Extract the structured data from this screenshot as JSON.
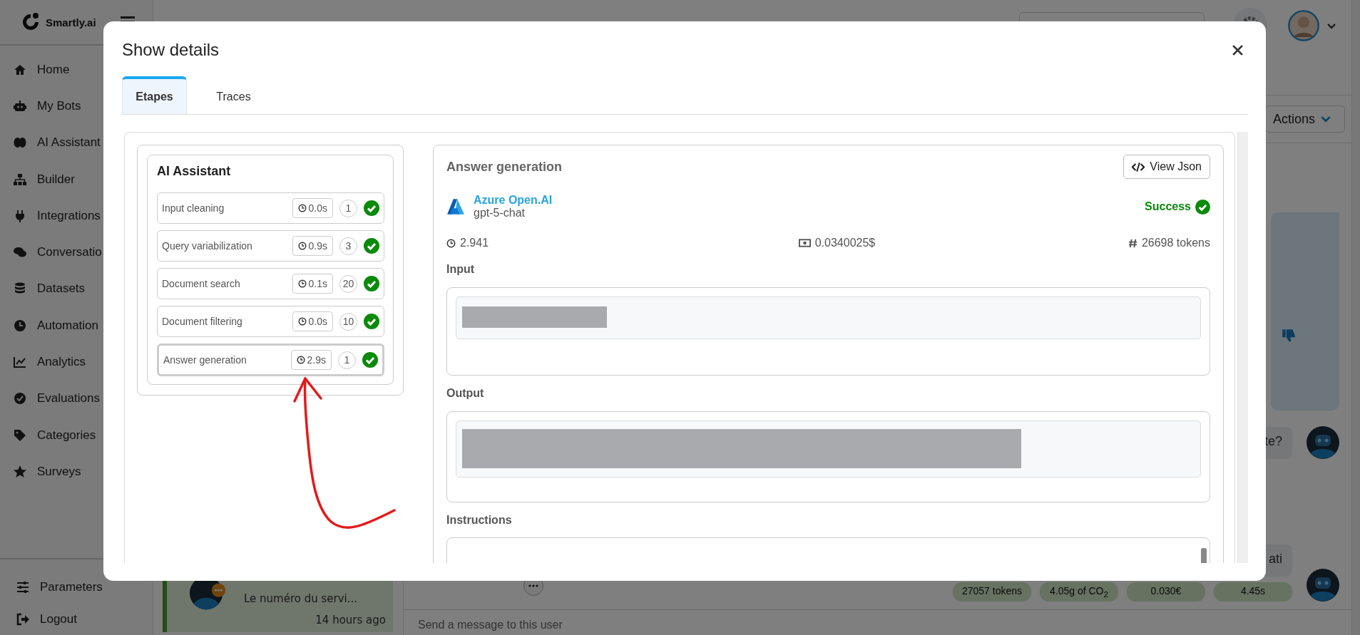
{
  "sidebar": {
    "brand": "Smartly.ai",
    "items": [
      {
        "label": "Home"
      },
      {
        "label": "My Bots"
      },
      {
        "label": "AI Assistant"
      },
      {
        "label": "Builder"
      },
      {
        "label": "Integrations"
      },
      {
        "label": "Conversatio"
      },
      {
        "label": "Datasets"
      },
      {
        "label": "Automation"
      },
      {
        "label": "Analytics"
      },
      {
        "label": "Evaluations"
      },
      {
        "label": "Categories"
      },
      {
        "label": "Surveys"
      }
    ],
    "footer_items": [
      {
        "label": "Parameters"
      },
      {
        "label": "Logout"
      }
    ]
  },
  "toolbar": {
    "actions_button": "Actions"
  },
  "conversation_list": {
    "items": [
      {
        "preview": "Le numéro du servi...",
        "time": "14 hours ago"
      }
    ]
  },
  "chat": {
    "messages": [
      {
        "text": "te?"
      },
      {
        "text": "ati"
      }
    ],
    "stats": [
      "27057 tokens",
      "4.05g of CO$_{2}$",
      "0.030€",
      "4.45s"
    ]
  },
  "composer": {
    "placeholder": "Send a message to this user"
  },
  "modal": {
    "title": "Show details",
    "tabs": [
      {
        "label": "Etapes",
        "selected": true
      },
      {
        "label": "Traces",
        "selected": false
      }
    ],
    "assistant": {
      "title": "AI Assistant",
      "steps": [
        {
          "name": "Input cleaning",
          "duration": "0.0s",
          "count": "1",
          "success": true,
          "selected": false
        },
        {
          "name": "Query variabilization",
          "duration": "0.9s",
          "count": "3",
          "success": true,
          "selected": false
        },
        {
          "name": "Document search",
          "duration": "0.1s",
          "count": "20",
          "success": true,
          "selected": false
        },
        {
          "name": "Document filtering",
          "duration": "0.0s",
          "count": "10",
          "success": true,
          "selected": false
        },
        {
          "name": "Answer generation",
          "duration": "2.9s",
          "count": "1",
          "success": true,
          "selected": true
        }
      ]
    },
    "detail": {
      "title": "Answer generation",
      "view_json": "View Json",
      "provider": "Azure Open.AI",
      "model": "gpt-5-chat",
      "status": "Success",
      "success": true,
      "duration": "2.941",
      "cost": "0.0340025$",
      "tokens": "26698 tokens",
      "sections": [
        {
          "label": "Input",
          "kind": "redacted"
        },
        {
          "label": "Output",
          "kind": "redacted"
        },
        {
          "label": "Instructions",
          "kind": "textarea"
        }
      ]
    }
  }
}
